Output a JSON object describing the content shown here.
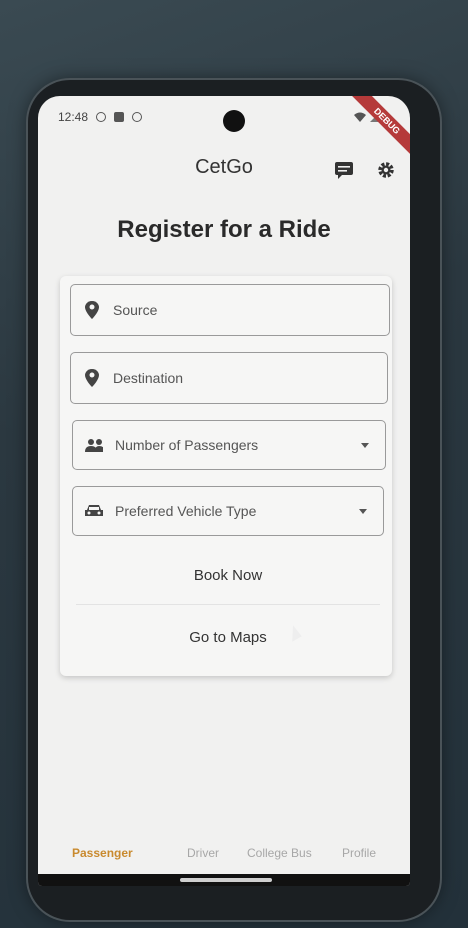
{
  "status_bar": {
    "time": "12:48",
    "debug_ribbon": "DEBUG"
  },
  "app_bar": {
    "title": "CetGo",
    "icons": [
      "chat-icon",
      "settings-icon"
    ]
  },
  "page": {
    "heading": "Register for a Ride"
  },
  "form": {
    "source_placeholder": "Source",
    "destination_placeholder": "Destination",
    "passengers_label": "Number of Passengers",
    "vehicle_label": "Preferred Vehicle Type",
    "book_now": "Book Now",
    "go_to_maps": "Go to Maps"
  },
  "bottom_nav": {
    "tabs": [
      {
        "label": "Passenger",
        "active": true
      },
      {
        "label": "Driver",
        "active": false
      },
      {
        "label": "College Bus",
        "active": false
      },
      {
        "label": "Profile",
        "active": false
      }
    ]
  },
  "colors": {
    "accent": "#c98a2e",
    "background": "#f1f1f0",
    "ribbon": "#b53a3a"
  }
}
